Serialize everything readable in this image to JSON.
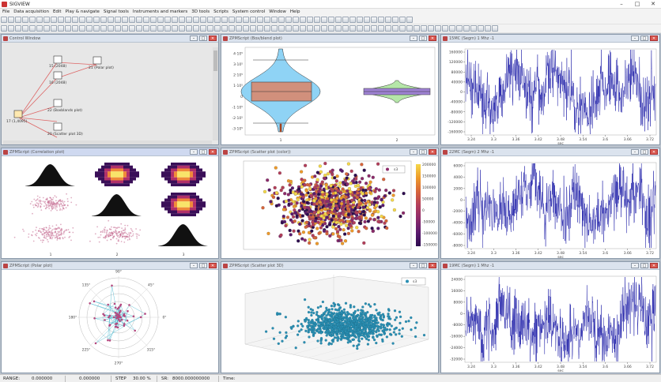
{
  "app": {
    "title": "SIGVIEW"
  },
  "menu": [
    "File",
    "Data acquisition",
    "Edit",
    "Play & navigate",
    "Signal tools",
    "Instruments and markers",
    "3D tools",
    "Scripts",
    "System control",
    "Window",
    "Help"
  ],
  "windows": {
    "control": {
      "title": "Control Window",
      "nodes": [
        "21 (Polar plot)",
        "15 (2048)",
        "16 (2048)",
        "17 (1,4095)",
        "22 (Boxblands plot)",
        "20 (Scatter plot 3D)"
      ]
    },
    "box": {
      "title": "ZPMScript (Box/blend plot)",
      "yticks": [
        "4·10⁵",
        "3·10⁵",
        "2·10⁵",
        "1·10⁵",
        "0",
        "-1·10⁵",
        "-2·10⁵",
        "-3·10⁵"
      ],
      "xticks": [
        "1",
        "2"
      ]
    },
    "sig1": {
      "title": "15MC (Segm) 1 Mhz -1",
      "yticks": [
        "160000",
        "120000",
        "80000",
        "40000",
        "0",
        "-40000",
        "-80000",
        "-120000",
        "-160000"
      ],
      "xticks": [
        "3.24",
        "3.3",
        "3.36",
        "3.42",
        "3.48",
        "3.54",
        "3.6",
        "3.66",
        "3.72"
      ],
      "xunit": "sec"
    },
    "corr": {
      "title": "ZPMScript (Correlation plot)",
      "xticks": [
        "1",
        "2",
        "3"
      ]
    },
    "scatter": {
      "title": "ZPMScript (Scatter plot (color))",
      "legend": "s3",
      "cbticks": [
        "200000",
        "150000",
        "100000",
        "50000",
        "0",
        "-50000",
        "-100000",
        "-150000"
      ]
    },
    "sig2": {
      "title": "22MC (Segm) 2 Mhz -1",
      "yticks": [
        "6000",
        "4000",
        "2000",
        "0",
        "-2000",
        "-4000",
        "-6000",
        "-8000"
      ],
      "xticks": [
        "3.24",
        "3.3",
        "3.36",
        "3.42",
        "3.48",
        "3.54",
        "3.6",
        "3.66",
        "3.72"
      ],
      "xunit": "sec"
    },
    "polar": {
      "title": "ZPMScript (Polar plot)",
      "angles": [
        "90°",
        "45°",
        "0°",
        "315°",
        "270°",
        "225°",
        "180°",
        "135°"
      ]
    },
    "scatter3d": {
      "title": "ZPMScript (Scatter plot 3D)",
      "legend": "s3"
    },
    "sig3": {
      "title": "19MC (Segm) 1 Mhz -1",
      "yticks": [
        "24000",
        "16000",
        "8000",
        "0",
        "-8000",
        "-16000",
        "-24000",
        "-32000"
      ],
      "xticks": [
        "3.24",
        "3.3",
        "3.36",
        "3.42",
        "3.48",
        "3.54",
        "3.6",
        "3.66",
        "3.72"
      ],
      "xunit": "sec"
    }
  },
  "status": {
    "range_label": "RANGE:",
    "range_value": "0.000000",
    "value2": "0.000000",
    "step_label": "STEP",
    "step_value": "30.00 %",
    "sr_label": "SR:",
    "sr_value": "8000.000000000",
    "time_label": "Time:"
  }
}
